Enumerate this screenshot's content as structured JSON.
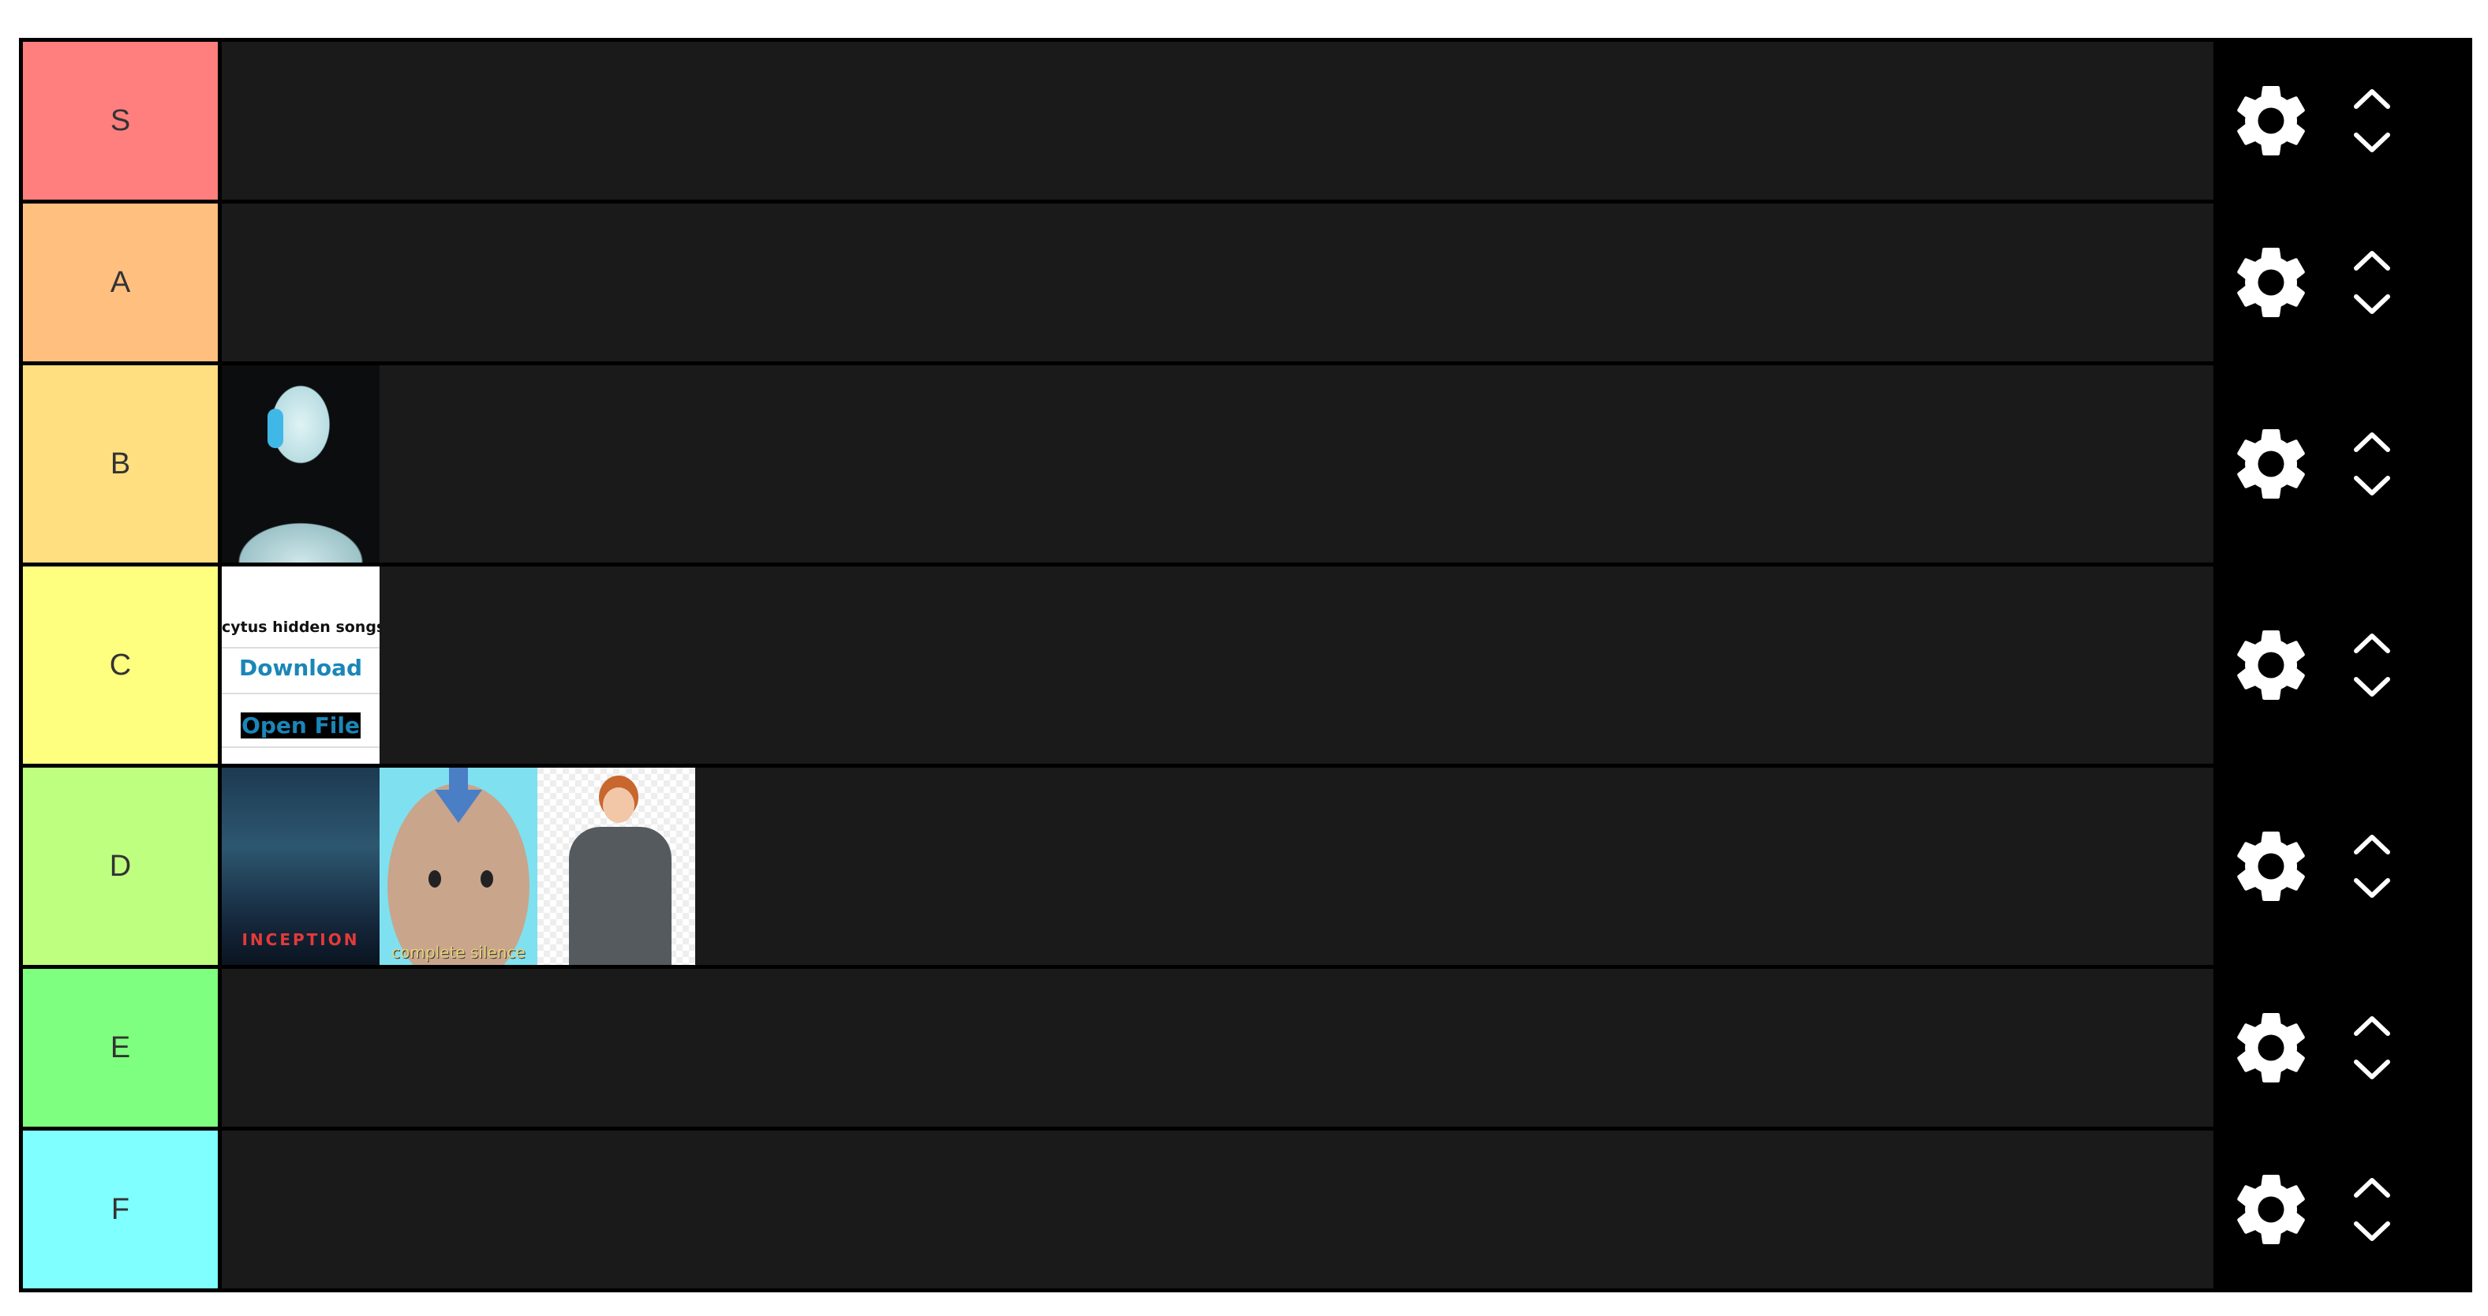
{
  "tiers": [
    {
      "label": "S",
      "color": "#ff7f7f",
      "tall": false,
      "items": []
    },
    {
      "label": "A",
      "color": "#ffbf7f",
      "tall": false,
      "items": []
    },
    {
      "label": "B",
      "color": "#ffdf7f",
      "tall": true,
      "items": [
        {
          "kind": "robot"
        }
      ]
    },
    {
      "label": "C",
      "color": "#ffff7f",
      "tall": true,
      "items": [
        {
          "kind": "cytus",
          "texts": [
            "cytus hidden songs",
            "Download",
            "Open File"
          ]
        }
      ]
    },
    {
      "label": "D",
      "color": "#bfff7f",
      "tall": true,
      "items": [
        {
          "kind": "inception",
          "texts": [
            "INCEPTION"
          ]
        },
        {
          "kind": "aang",
          "texts": [
            "complete silence"
          ]
        },
        {
          "kind": "ron"
        }
      ]
    },
    {
      "label": "E",
      "color": "#7fff7f",
      "tall": false,
      "items": []
    },
    {
      "label": "F",
      "color": "#7fffff",
      "tall": false,
      "items": []
    }
  ],
  "controls": {
    "settings_icon": "gear-icon",
    "up_icon": "chevron-up-icon",
    "down_icon": "chevron-down-icon"
  },
  "colors": {
    "row_background": "#1a1a1a",
    "controls_background": "#000000"
  }
}
